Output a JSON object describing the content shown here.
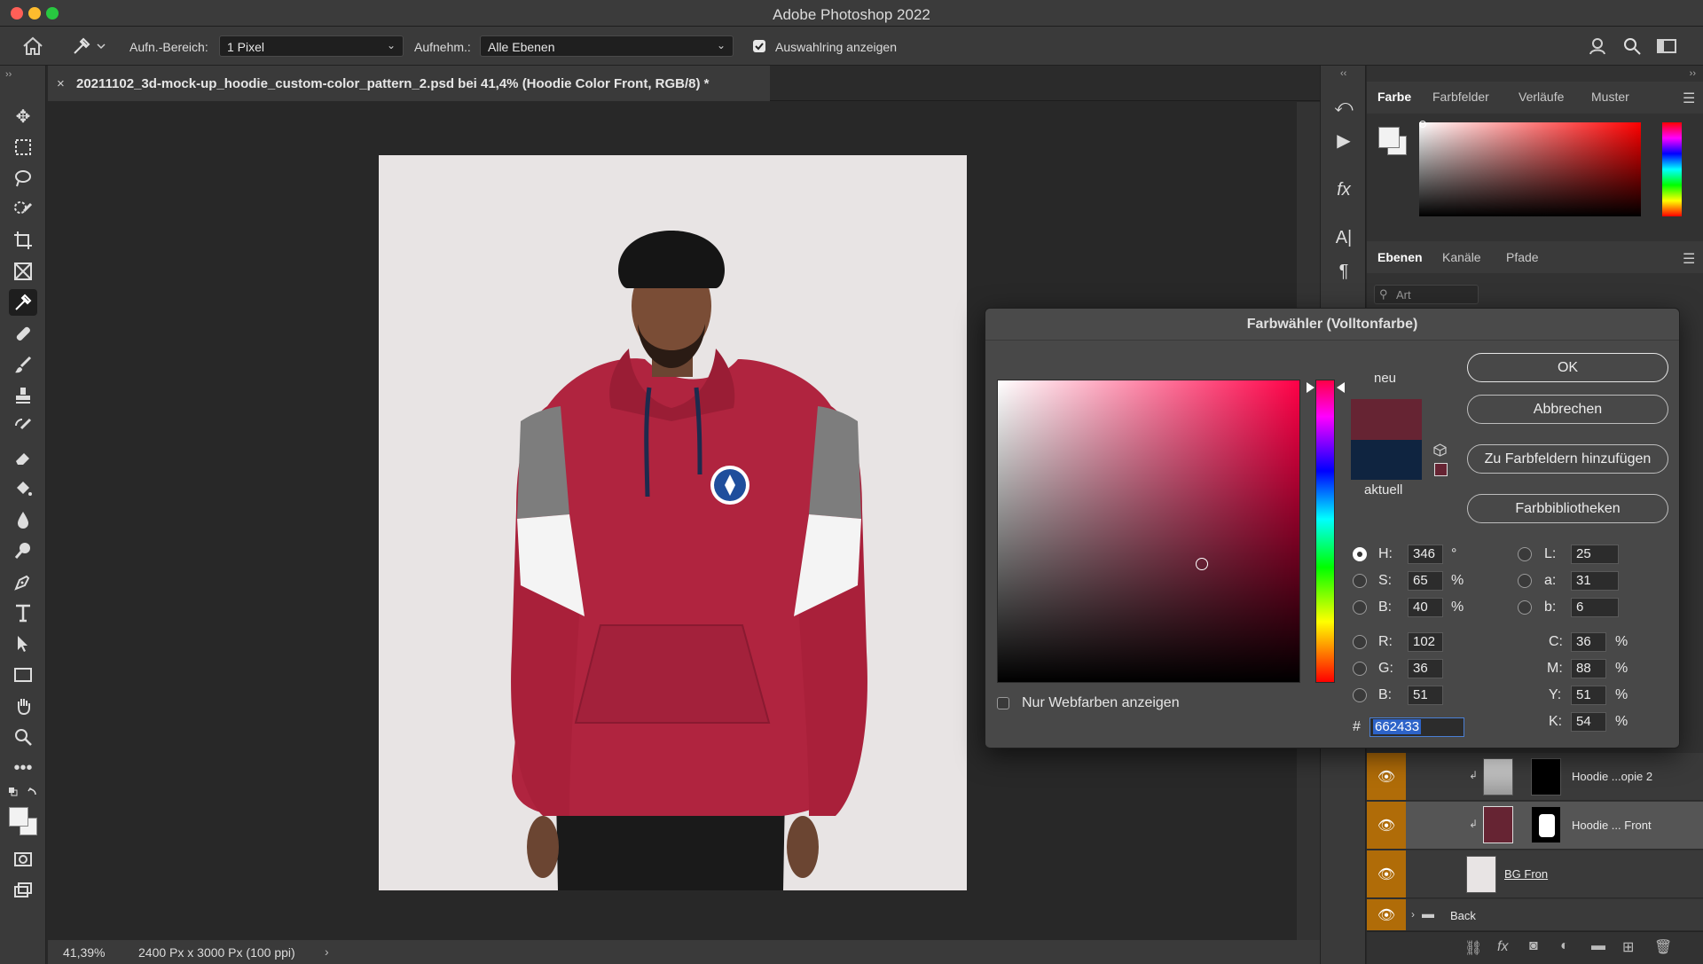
{
  "app": {
    "title": "Adobe Photoshop 2022"
  },
  "options_bar": {
    "sample_size_label": "Aufn.-Bereich:",
    "sample_size_value": "1 Pixel",
    "sample_label": "Aufnehm.:",
    "sample_value": "Alle Ebenen",
    "show_ring_label": "Auswahlring anzeigen",
    "show_ring_checked": true
  },
  "document": {
    "tab_title": "20211102_3d-mock-up_hoodie_custom-color_pattern_2.psd bei 41,4% (Hoodie Color Front, RGB/8) *",
    "zoom": "41,39%",
    "doc_info": "2400 Px x 3000 Px (100 ppi)"
  },
  "panels": {
    "color_tabs": [
      "Farbe",
      "Farbfelder",
      "Verläufe",
      "Muster"
    ],
    "layer_tabs": [
      "Ebenen",
      "Kanäle",
      "Pfade"
    ],
    "layer_filter_placeholder": "Art",
    "layers": [
      {
        "name": "Hoodie ...opie 2",
        "selected": false
      },
      {
        "name": "Hoodie ... Front",
        "selected": true
      },
      {
        "name": "BG Fron",
        "selected": false
      },
      {
        "name": "Back",
        "selected": false,
        "group": true
      }
    ]
  },
  "color_picker": {
    "title": "Farbwähler (Volltonfarbe)",
    "new_label": "neu",
    "current_label": "aktuell",
    "new_color": "#662433",
    "current_color": "#0f2440",
    "buttons": {
      "ok": "OK",
      "cancel": "Abbrechen",
      "add_swatch": "Zu Farbfeldern hinzufügen",
      "libraries": "Farbbibliotheken"
    },
    "web_colors_label": "Nur Webfarben anzeigen",
    "hsb": {
      "h_label": "H:",
      "h": "346",
      "h_unit": "°",
      "s_label": "S:",
      "s": "65",
      "s_unit": "%",
      "b_label": "B:",
      "b": "40",
      "b_unit": "%"
    },
    "rgb": {
      "r_label": "R:",
      "r": "102",
      "g_label": "G:",
      "g": "36",
      "b_label": "B:",
      "b": "51"
    },
    "lab": {
      "l_label": "L:",
      "l": "25",
      "a_label": "a:",
      "a": "31",
      "b_label": "b:",
      "b": "6"
    },
    "cmyk": {
      "c_label": "C:",
      "c": "36",
      "m_label": "M:",
      "m": "88",
      "y_label": "Y:",
      "y": "51",
      "k_label": "K:",
      "k": "54",
      "unit": "%"
    },
    "hex_label": "#",
    "hex": "662433"
  }
}
